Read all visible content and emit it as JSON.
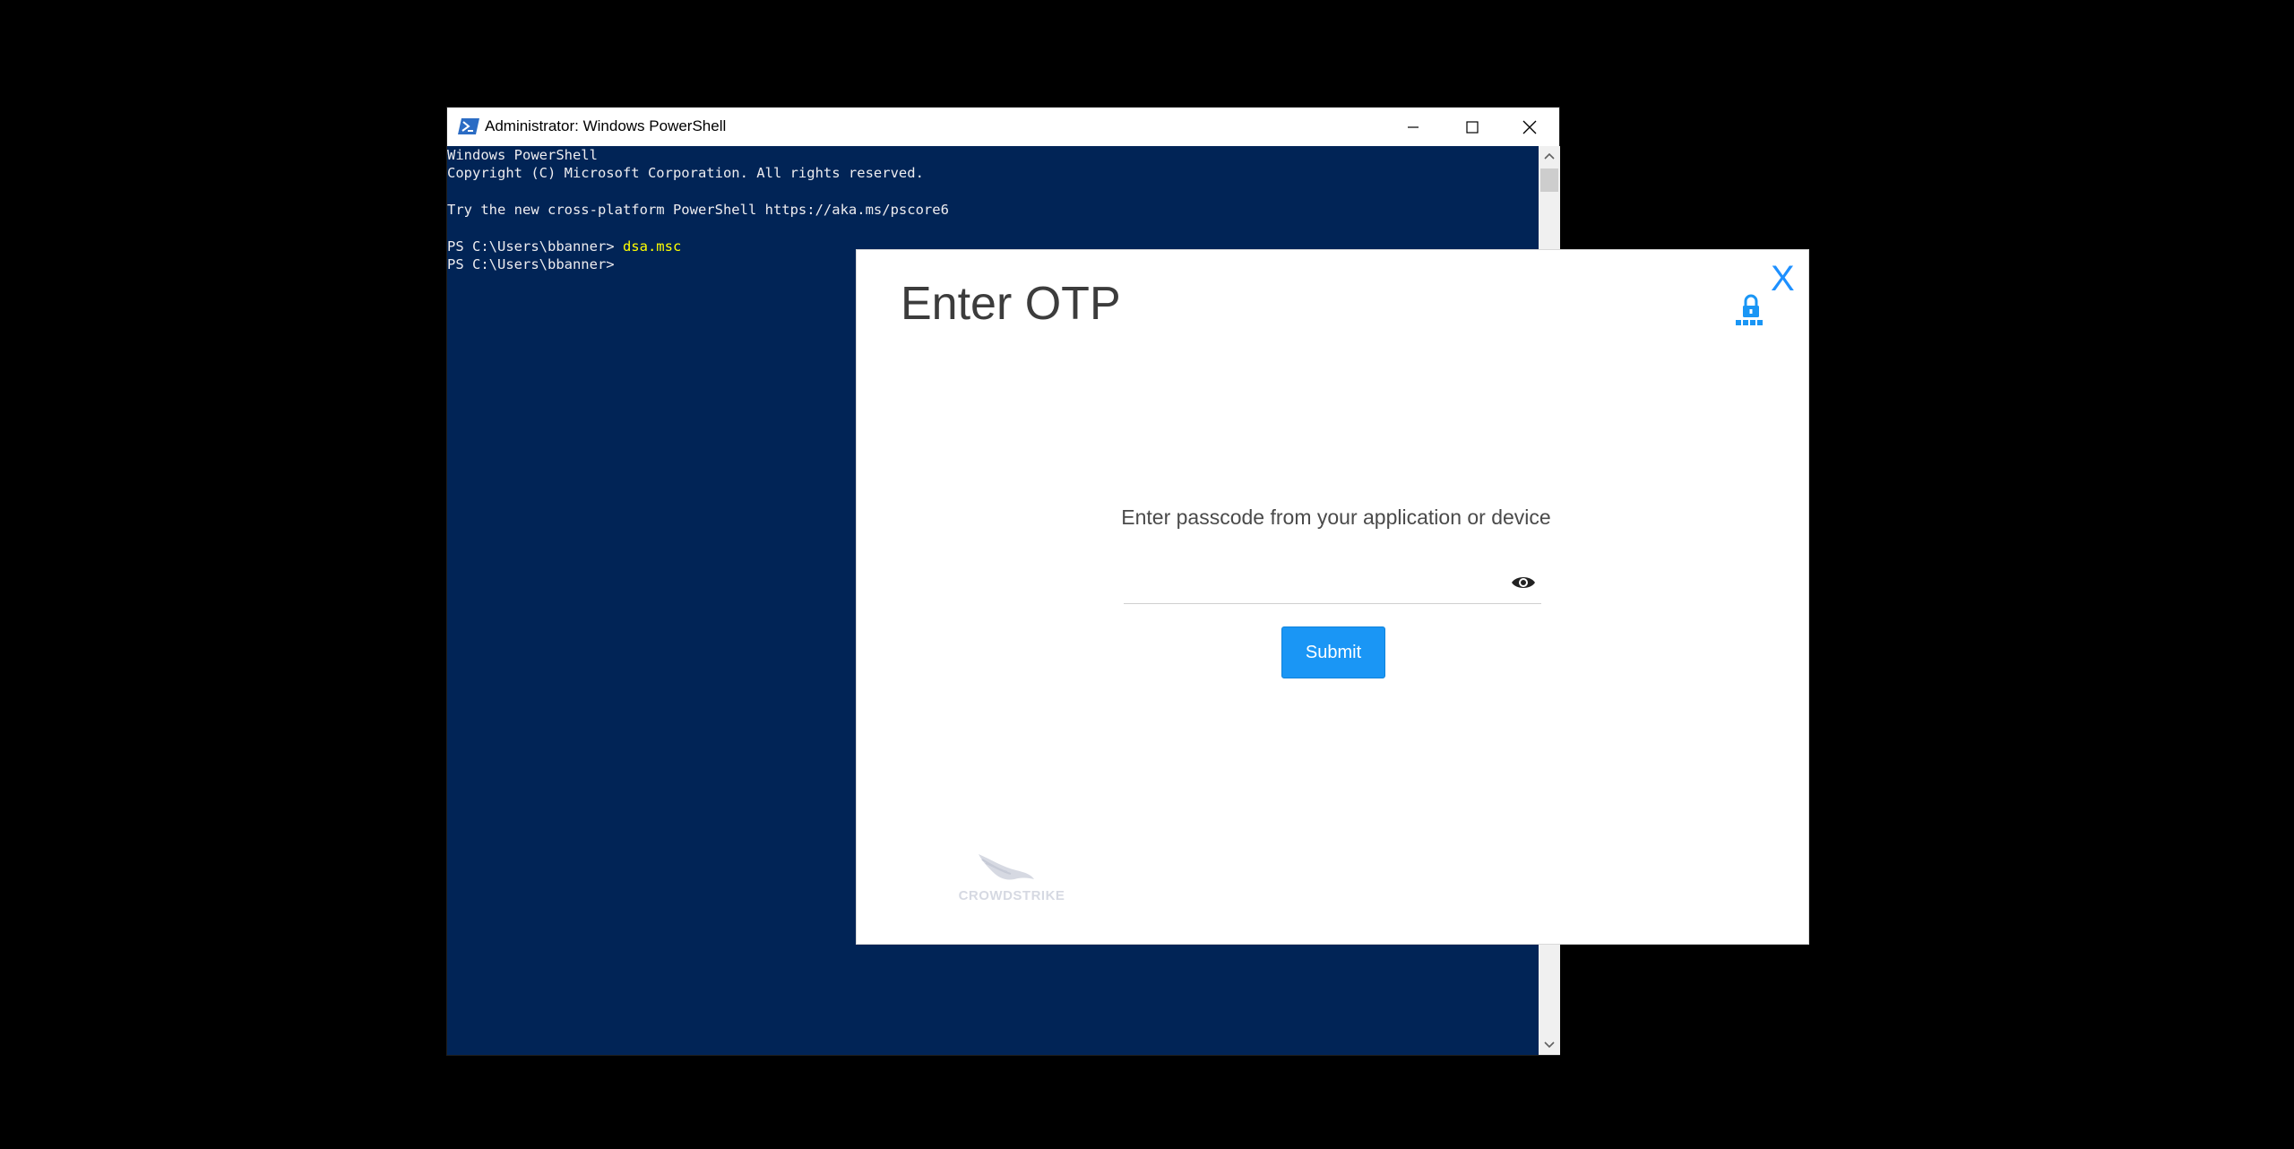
{
  "powershell": {
    "title": "Administrator: Windows PowerShell",
    "icon": "powershell-icon",
    "console_lines": [
      {
        "text": "Windows PowerShell",
        "cmd": ""
      },
      {
        "text": "Copyright (C) Microsoft Corporation. All rights reserved.",
        "cmd": ""
      },
      {
        "text": "",
        "cmd": ""
      },
      {
        "text": "Try the new cross-platform PowerShell https://aka.ms/pscore6",
        "cmd": ""
      },
      {
        "text": "",
        "cmd": ""
      },
      {
        "text": "PS C:\\Users\\bbanner> ",
        "cmd": "dsa.msc"
      },
      {
        "text": "PS C:\\Users\\bbanner>",
        "cmd": ""
      }
    ],
    "colors": {
      "console_bg": "#012456",
      "console_text": "#eeedf0",
      "command_text": "#ffff00"
    }
  },
  "otp_dialog": {
    "title": "Enter OTP",
    "close_label": "X",
    "prompt": "Enter passcode from your application or device",
    "input_value": "",
    "submit_label": "Submit",
    "brand": "CROWDSTRIKE",
    "colors": {
      "accent": "#1a96f5",
      "title_text": "#3c3c3c"
    }
  }
}
